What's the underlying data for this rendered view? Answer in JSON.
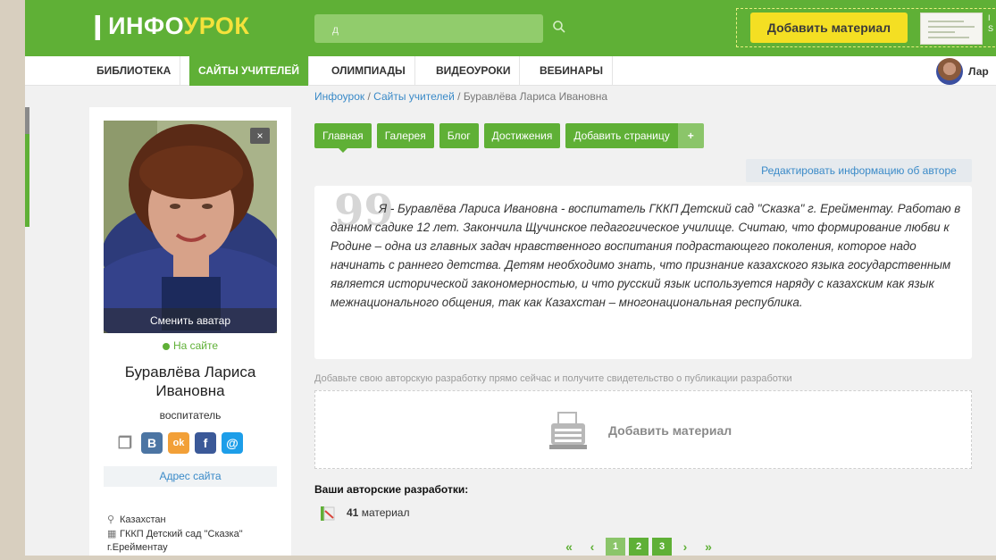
{
  "header": {
    "logo_mark": "❙",
    "logo_part1": "ИНФО",
    "logo_part2": "УРОК",
    "search_value": "д",
    "add_material_button": "Добавить материал",
    "edge_text": "I\nS"
  },
  "nav": {
    "items": [
      {
        "label": "Библиотека",
        "active": false
      },
      {
        "label": "Сайты учителей",
        "active": true
      },
      {
        "label": "Олимпиады",
        "active": false
      },
      {
        "label": "Видеоуроки",
        "active": false
      },
      {
        "label": "Вебинары",
        "active": false
      }
    ],
    "user_name": "Лар"
  },
  "sidebar": {
    "change_avatar": "Сменить аватар",
    "close_label": "×",
    "status": "На сайте",
    "name_line1": "Буравлёва Лариса",
    "name_line2": "Ивановна",
    "role": "воспитатель",
    "socials": [
      {
        "name": "copy",
        "glyph": "❐"
      },
      {
        "name": "vk",
        "glyph": "В"
      },
      {
        "name": "odnoklassniki",
        "glyph": "ok"
      },
      {
        "name": "facebook",
        "glyph": "f"
      },
      {
        "name": "mail",
        "glyph": "@"
      }
    ],
    "site_link": "Адрес сайта",
    "country": "Казахстан",
    "organization_line1": "ГККП Детский сад \"Сказка\"",
    "organization_line2": "г.Ерейментау"
  },
  "breadcrumb": {
    "items": [
      "Инфоурок",
      "Сайты учителей",
      "Буравлёва Лариса Ивановна"
    ],
    "separator": "/"
  },
  "tabs": [
    {
      "label": "Главная",
      "active": true
    },
    {
      "label": "Галерея",
      "active": false
    },
    {
      "label": "Блог",
      "active": false
    },
    {
      "label": "Достижения",
      "active": false
    },
    {
      "label": "Добавить страницу",
      "active": false
    },
    {
      "label": "+",
      "active": false
    }
  ],
  "edit_info": "Редактировать информацию об авторе",
  "about_text": "Я - Буравлёва Лариса Ивановна - воспитатель ГККП Детский сад \"Сказка\" г. Ерейментау. Работаю в данном садике 12 лет. Закончила Щучинское педагогическое училище. Считаю, что формирование любви к Родине – одна из главных задач нравственного воспитания подрастающего поколения, которое надо начинать с раннего детства. Детям необходимо знать, что признание казахского языка государственным является исторической закономерностью, и что русский язык используется наряду с казахским как язык межнационального общения, так как Казахстан – многонациональная республика.",
  "quote_mark": "99",
  "promo_text": "Добавьте свою авторскую разработку прямо сейчас и получите свидетельство о публикации разработки",
  "add_material_label": "Добавить материал",
  "works": {
    "title": "Ваши авторские разработки:",
    "count": "41",
    "count_label": "материал"
  },
  "pager": {
    "first": "«",
    "prev": "‹",
    "pages": [
      "1",
      "2",
      "3"
    ],
    "current": "1",
    "next": "›",
    "last": "»"
  },
  "colors": {
    "brand_green": "#5fb036",
    "accent_yellow": "#f4df23",
    "link_blue": "#3a8ac8"
  }
}
